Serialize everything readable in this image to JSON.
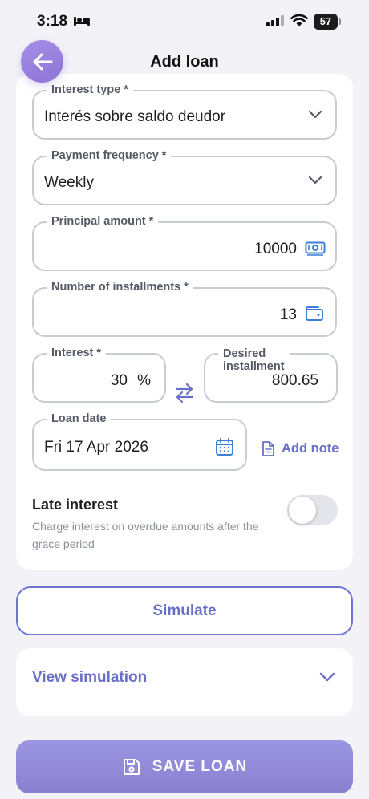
{
  "status_bar": {
    "time": "3:18",
    "battery": "57"
  },
  "header": {
    "title": "Add loan"
  },
  "form": {
    "interest_type": {
      "label": "Interest type *",
      "value": "Interés sobre saldo deudor"
    },
    "payment_frequency": {
      "label": "Payment frequency *",
      "value": "Weekly"
    },
    "principal_amount": {
      "label": "Principal amount *",
      "value": "10000"
    },
    "installments": {
      "label": "Number of installments *",
      "value": "13"
    },
    "interest": {
      "label": "Interest *",
      "value": "30",
      "unit": "%"
    },
    "desired_installment": {
      "label_line1": "Desired",
      "label_line2": "installment",
      "value": "800.65"
    },
    "loan_date": {
      "label": "Loan date",
      "value": "Fri 17 Apr 2026"
    },
    "add_note_label": "Add note",
    "late_interest": {
      "title": "Late interest",
      "description": "Charge interest on overdue amounts after the grace period",
      "enabled": false
    }
  },
  "actions": {
    "simulate_label": "Simulate",
    "view_simulation_label": "View simulation",
    "save_label": "SAVE LOAN"
  },
  "colors": {
    "accent": "#6a70c8",
    "back_button": "#9a82df",
    "save_gradient_top": "#9b96e2",
    "save_gradient_bottom": "#8a7fd0",
    "field_border": "#c8ccd2",
    "background": "#f2f2f7",
    "icon_blue": "#3b7fd6"
  },
  "icons": {
    "back": "arrow-left-icon",
    "dropdown": "chevron-down-icon",
    "money": "banknote-icon",
    "wallet": "wallet-icon",
    "swap": "swap-arrows-icon",
    "calendar": "calendar-icon",
    "note": "document-icon",
    "save": "floppy-disk-icon"
  }
}
